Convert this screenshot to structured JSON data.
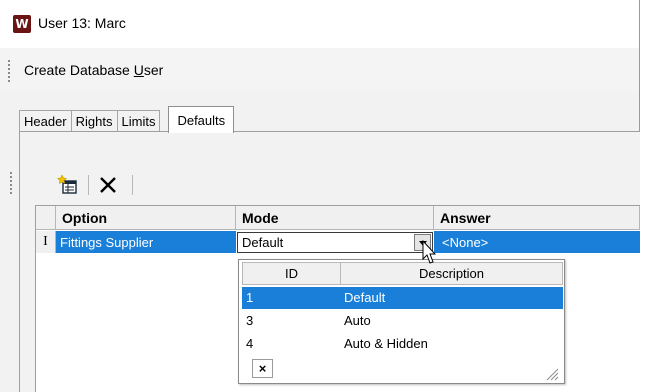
{
  "window": {
    "title": "User 13: Marc"
  },
  "command": {
    "prefix": "Create Database ",
    "underlined": "U",
    "suffix": "ser"
  },
  "tabs": [
    {
      "label": "Header"
    },
    {
      "label": "Rights"
    },
    {
      "label": "Limits"
    },
    {
      "label": "Defaults",
      "active": true
    }
  ],
  "toolbar": {
    "new_icon": "new-record-icon",
    "delete_icon": "delete-x-icon"
  },
  "grid": {
    "columns": [
      "Option",
      "Mode",
      "Answer"
    ],
    "row": {
      "indicator": "I",
      "option": "Fittings Supplier",
      "mode": "Default",
      "answer": "<None>"
    }
  },
  "dropdown": {
    "columns": [
      "ID",
      "Description"
    ],
    "items": [
      {
        "id": "1",
        "description": "Default",
        "selected": true
      },
      {
        "id": "3",
        "description": "Auto"
      },
      {
        "id": "4",
        "description": "Auto & Hidden"
      }
    ],
    "close_label": "×"
  },
  "colors": {
    "selection": "#1a7fd8",
    "app_icon": "#6b1414"
  }
}
